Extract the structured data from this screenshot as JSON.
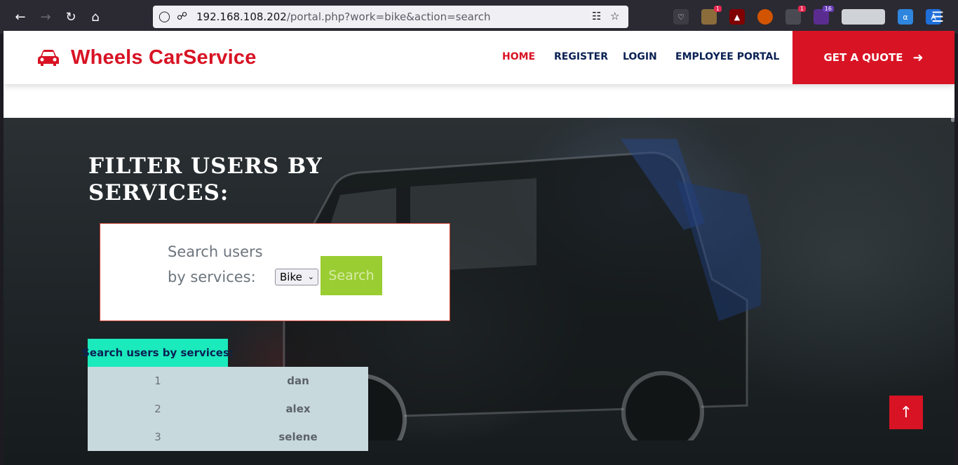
{
  "browser": {
    "url_host": "192.168.108.202",
    "url_path": "/portal.php?work=bike&action=search",
    "extension_badges": [
      "1",
      "1",
      "16"
    ]
  },
  "header": {
    "brand": "Wheels CarService",
    "nav": [
      {
        "label": "HOME",
        "active": true
      },
      {
        "label": "REGISTER",
        "active": false
      },
      {
        "label": "LOGIN",
        "active": false
      },
      {
        "label": "EMPLOYEE PORTAL",
        "active": false
      }
    ],
    "quote_label": "GET A QUOTE"
  },
  "main": {
    "title": "FILTER USERS BY SERVICES:",
    "search_label": "Search users by services:",
    "select_value": "Bike",
    "search_button": "Search",
    "results_header": "Search users by services:",
    "results": [
      {
        "id": "1",
        "name": "dan"
      },
      {
        "id": "2",
        "name": "alex"
      },
      {
        "id": "3",
        "name": "selene"
      }
    ]
  },
  "colors": {
    "brand_red": "#d81324",
    "navy": "#0b2154",
    "search_green": "#9acd32",
    "results_head": "#1aeabc",
    "results_bg": "#c8d9dd"
  },
  "icons": {
    "brand": "car-icon",
    "quote": "arrow-right-icon",
    "back_top": "arrow-up-icon"
  }
}
